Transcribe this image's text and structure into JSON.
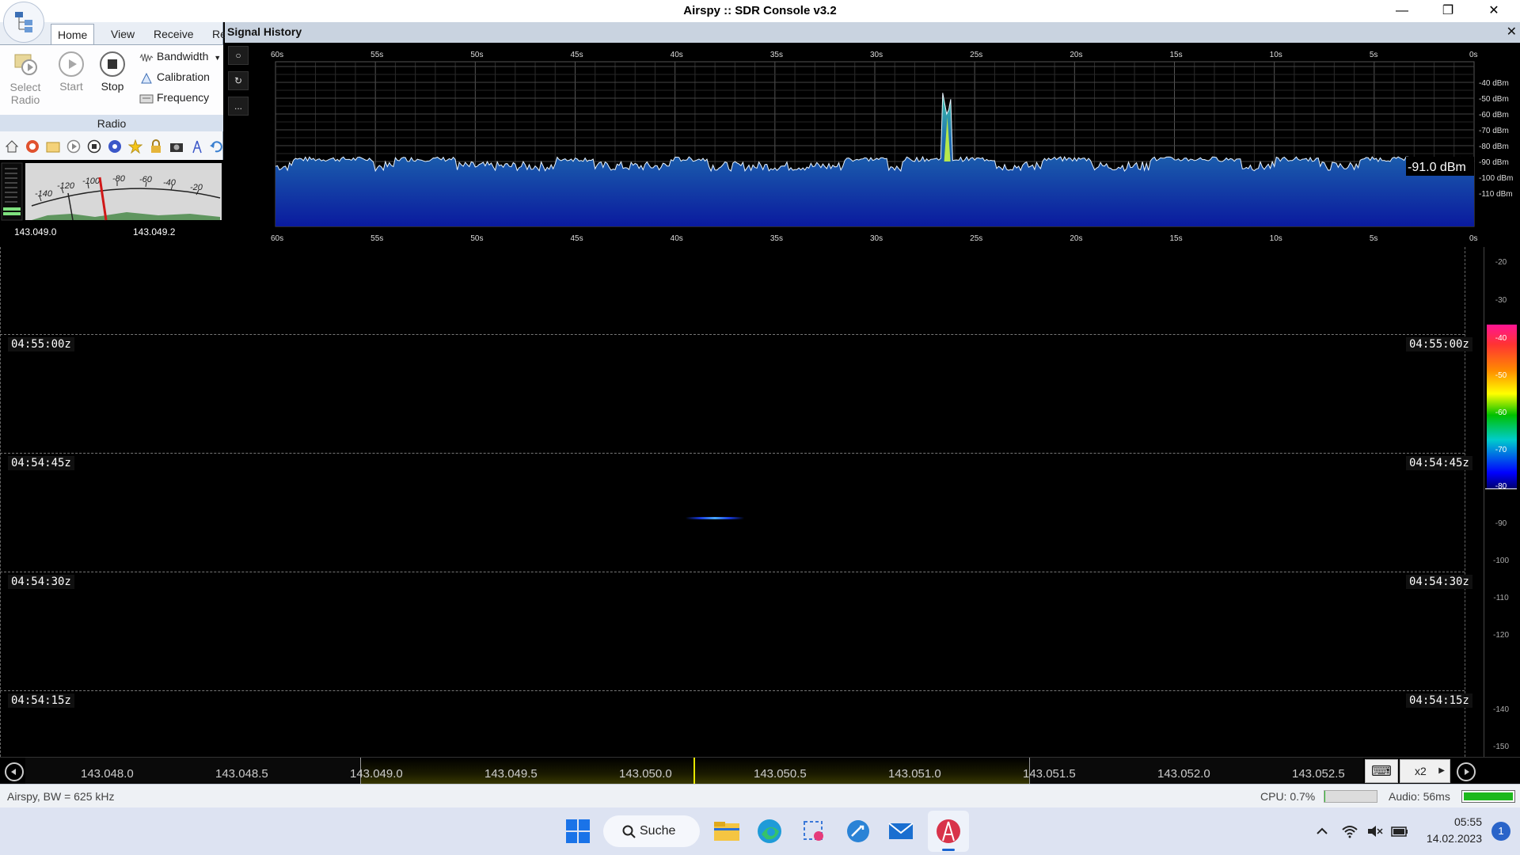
{
  "window": {
    "title": "Airspy :: SDR Console v3.2",
    "minimize": "—",
    "restore": "❐",
    "close": "✕"
  },
  "ribbon": {
    "tabs": [
      "Home",
      "View",
      "Receive",
      "Re"
    ],
    "active_tab": "Home",
    "select_radio": [
      "Select",
      "Radio"
    ],
    "start": "Start",
    "stop": "Stop",
    "bandwidth": "Bandwidth",
    "calibration": "Calibration",
    "frequency": "Frequency",
    "group_label": "Radio"
  },
  "smeter": {
    "scale": [
      "-140",
      "-120",
      "-100",
      "-80",
      "-60",
      "-40",
      "-20"
    ],
    "freq_left": "143.049.0",
    "freq_right": "143.049.2"
  },
  "signal_history": {
    "title": "Signal History",
    "close": "✕",
    "time_ticks": [
      "60s",
      "55s",
      "50s",
      "45s",
      "40s",
      "35s",
      "30s",
      "25s",
      "20s",
      "15s",
      "10s",
      "5s",
      "0s"
    ],
    "db_ticks": [
      "-40 dBm",
      "-50 dBm",
      "-60 dBm",
      "-70 dBm",
      "-80 dBm",
      "-90 dBm",
      "-100 dBm",
      "-110 dBm"
    ],
    "current_level": "-91.0 dBm",
    "side_buttons": [
      "○",
      "↻",
      "..."
    ]
  },
  "waterfall": {
    "timestamps": [
      "04:55:00z",
      "04:54:45z",
      "04:54:30z",
      "04:54:15z"
    ],
    "colorbar_labels": [
      "-20",
      "-30",
      "-40",
      "-50",
      "-60",
      "-70",
      "-80",
      "-90",
      "-100",
      "-110",
      "-120",
      "-140",
      "-150"
    ],
    "colors": {
      "top": "#ff1493",
      "orange": "#ff8c00",
      "yellow": "#ffff00",
      "green": "#00c000",
      "cyan": "#00cccc",
      "blue": "#0000ff"
    }
  },
  "freq_scale": {
    "labels": [
      "143.048.0",
      "143.048.5",
      "143.049.0",
      "143.049.5",
      "143.050.0",
      "143.050.5",
      "143.051.0",
      "143.051.5",
      "143.052.0",
      "143.052.5"
    ],
    "zoom": "x2",
    "keyboard_icon": "⌨"
  },
  "status": {
    "left": "Airspy, BW = 625 kHz",
    "cpu": "CPU: 0.7%",
    "audio": "Audio: 56ms"
  },
  "taskbar": {
    "search": "Suche",
    "time": "05:55",
    "date": "14.02.2023",
    "notifications": "1"
  }
}
